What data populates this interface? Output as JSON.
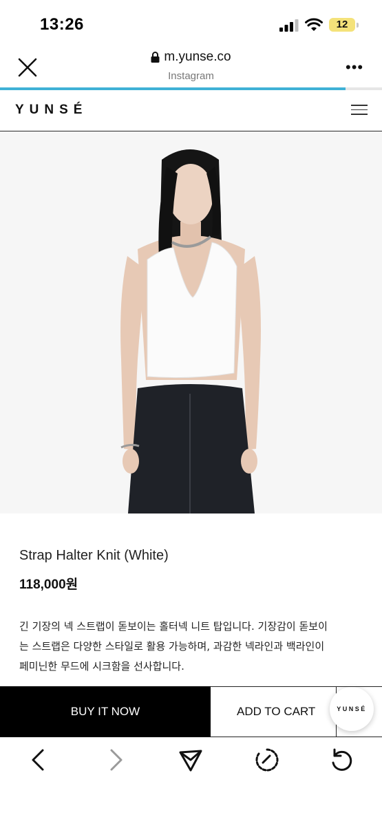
{
  "status_bar": {
    "time": "13:26",
    "battery": "12"
  },
  "browser": {
    "url": "m.yunse.co",
    "subtitle": "Instagram",
    "more": "•••",
    "load_progress": 0.905
  },
  "site": {
    "logo": "YUNSÉ"
  },
  "product": {
    "name": "Strap Halter Knit (White)",
    "price": "118,000원",
    "description": [
      "긴 기장의 넥 스트랩이 돋보이는 홀터넥 니트 탑입니다. 기장감이 돋보이",
      "는 스트랩은 다양한 스타일로 활용 가능하며, 과감한 넥라인과 백라인이",
      "페미닌한 무드에 시크함을 선사합니다."
    ]
  },
  "actions": {
    "buy_now": "BUY IT NOW",
    "add_to_cart": "ADD TO CART",
    "floating_logo": "YUNSÉ"
  },
  "colors": {
    "accent": "#3fb1d6",
    "battery": "#f4e27a",
    "button_dark": "#000000"
  },
  "icons": [
    "close-icon",
    "lock-icon",
    "more-icon",
    "menu-icon",
    "back-icon",
    "forward-icon",
    "share-icon",
    "refresh-icon",
    "reload-icon",
    "cellular-signal-icon",
    "wifi-icon",
    "battery-icon"
  ]
}
